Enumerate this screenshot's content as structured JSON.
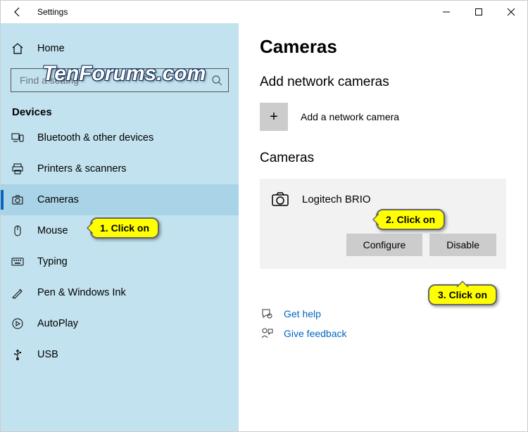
{
  "window": {
    "title": "Settings"
  },
  "sidebar": {
    "home_label": "Home",
    "search_placeholder": "Find a setting",
    "section_label": "Devices",
    "items": [
      {
        "label": "Bluetooth & other devices"
      },
      {
        "label": "Printers & scanners"
      },
      {
        "label": "Cameras"
      },
      {
        "label": "Mouse"
      },
      {
        "label": "Typing"
      },
      {
        "label": "Pen & Windows Ink"
      },
      {
        "label": "AutoPlay"
      },
      {
        "label": "USB"
      }
    ]
  },
  "content": {
    "page_title": "Cameras",
    "add_heading": "Add network cameras",
    "add_label": "Add a network camera",
    "cameras_heading": "Cameras",
    "device_name": "Logitech BRIO",
    "configure_label": "Configure",
    "disable_label": "Disable",
    "help_label": "Get help",
    "feedback_label": "Give feedback"
  },
  "annotations": {
    "callout1": "1. Click on",
    "callout2": "2. Click on",
    "callout3": "3. Click on",
    "watermark": "TenForums.com"
  }
}
